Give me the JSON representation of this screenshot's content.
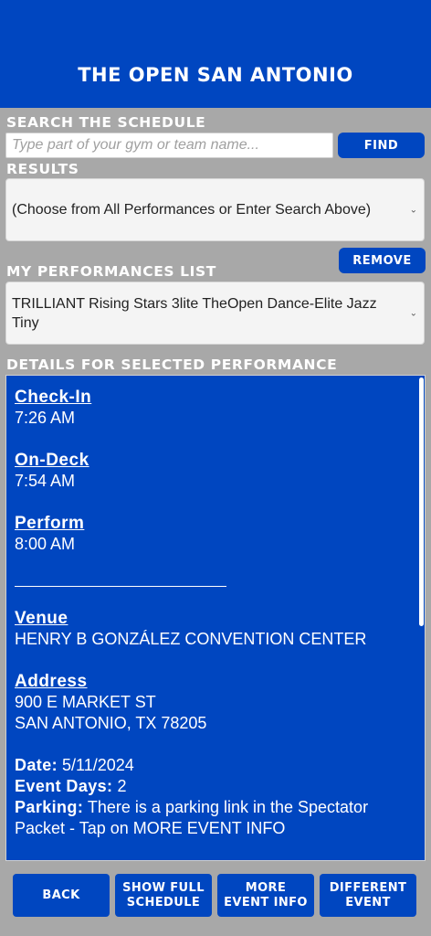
{
  "header": {
    "title": "THE OPEN SAN ANTONIO"
  },
  "search": {
    "label": "SEARCH THE SCHEDULE",
    "placeholder": "Type part of your gym or team name...",
    "find_label": "FIND"
  },
  "results": {
    "label": "RESULTS",
    "selected": "(Choose from All Performances or Enter Search Above)"
  },
  "my_performances": {
    "label": "MY PERFORMANCES LIST",
    "remove_label": "REMOVE",
    "selected": "TRILLIANT Rising Stars 3lite TheOpen Dance-Elite Jazz Tiny"
  },
  "details": {
    "label": "DETAILS FOR SELECTED PERFORMANCE",
    "checkin_label": "Check-In",
    "checkin_value": "7:26 AM",
    "ondeck_label": "On-Deck",
    "ondeck_value": "7:54 AM",
    "perform_label": "Perform",
    "perform_value": "8:00 AM",
    "venue_label": "Venue",
    "venue_value": "HENRY B GONZÁLEZ CONVENTION CENTER",
    "address_label": "Address",
    "address_line1": "900 E MARKET ST",
    "address_line2": "SAN ANTONIO, TX 78205",
    "date_label": "Date:",
    "date_value": "5/11/2024",
    "event_days_label": "Event Days:",
    "event_days_value": "2",
    "parking_label": "Parking:",
    "parking_value": "There is a parking link in the Spectator Packet - Tap on MORE EVENT INFO"
  },
  "footer": {
    "back": "BACK",
    "show_full_schedule": "SHOW FULL\nSCHEDULE",
    "more_event_info": "MORE\nEVENT INFO",
    "different_event": "DIFFERENT\nEVENT"
  },
  "colors": {
    "primary_blue": "#0046c0",
    "background_gray": "#a8a8a8",
    "white": "#ffffff"
  }
}
